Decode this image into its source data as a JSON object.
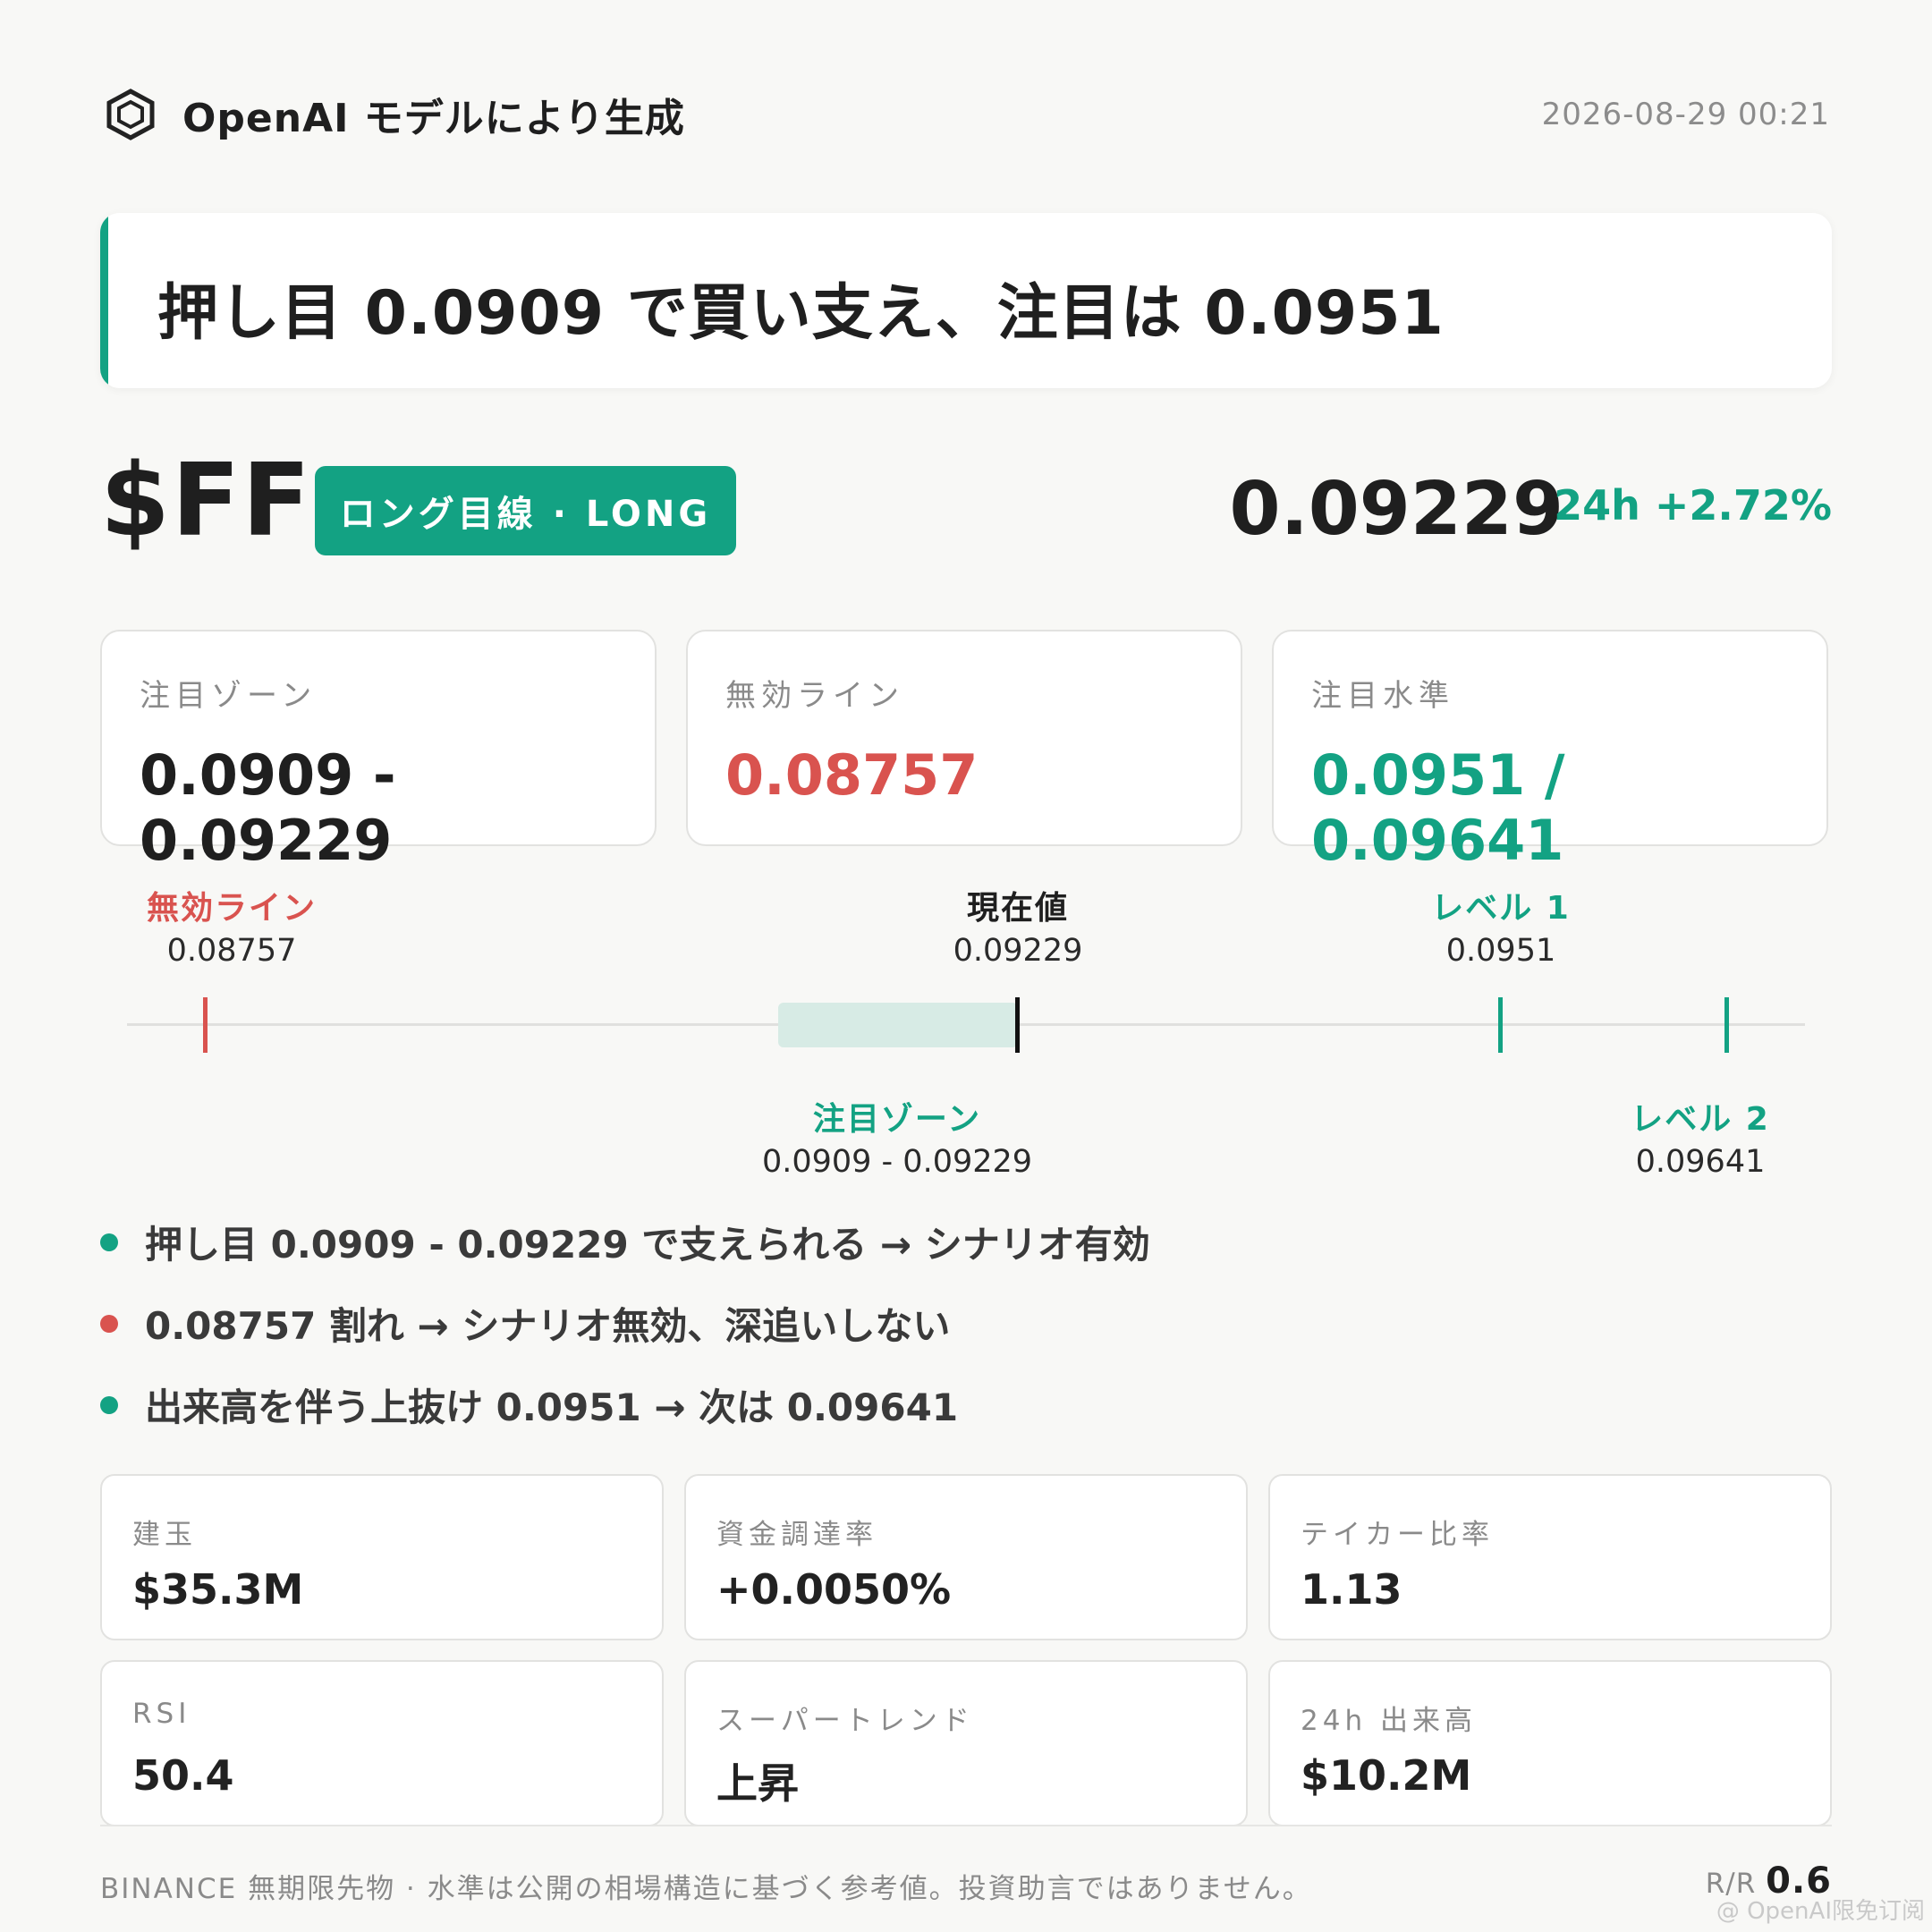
{
  "header": {
    "title": "OpenAI モデルにより生成",
    "timestamp": "2026-08-29 00:21"
  },
  "headline": "押し目 0.0909 で買い支え、注目は 0.0951",
  "ticker": {
    "symbol": "$FF",
    "badge": "ロング目線 · LONG",
    "price": "0.09229",
    "change": "24h +2.72%"
  },
  "levels": [
    {
      "label": "注目ゾーン",
      "value": "0.0909 - 0.09229",
      "color": "#1f1f1f"
    },
    {
      "label": "無効ライン",
      "value": "0.08757",
      "color": "#d9534f"
    },
    {
      "label": "注目水準",
      "value": "0.0951 / 0.09641",
      "color": "#13a283"
    }
  ],
  "track": {
    "invalid": {
      "label": "無効ライン",
      "value": "0.08757"
    },
    "current": {
      "label": "現在値",
      "value": "0.09229"
    },
    "level1": {
      "label": "レベル 1",
      "value": "0.0951"
    },
    "zone": {
      "label": "注目ゾーン",
      "value": "0.0909 - 0.09229"
    },
    "level2": {
      "label": "レベル 2",
      "value": "0.09641"
    }
  },
  "bullets": [
    {
      "text": "押し目 0.0909 - 0.09229 で支えられる → シナリオ有効",
      "color": "#13a283"
    },
    {
      "text": "0.08757 割れ → シナリオ無効、深追いしない",
      "color": "#d9534f"
    },
    {
      "text": "出来高を伴う上抜け 0.0951 → 次は 0.09641",
      "color": "#13a283"
    }
  ],
  "metrics": [
    {
      "label": "建玉",
      "value": "$35.3M"
    },
    {
      "label": "資金調達率",
      "value": "+0.0050%"
    },
    {
      "label": "テイカー比率",
      "value": "1.13"
    },
    {
      "label": "RSI",
      "value": "50.4"
    },
    {
      "label": "スーパートレンド",
      "value": "上昇"
    },
    {
      "label": "24h 出来高",
      "value": "$10.2M"
    }
  ],
  "footer": {
    "note": "BINANCE 無期限先物 · 水準は公開の相場構造に基づく参考値。投資助言ではありません。",
    "rr_label": "R/R",
    "rr_value": "0.6"
  },
  "watermark": "@ OpenAI限免订阅",
  "colors": {
    "accent": "#13a283",
    "danger": "#d9534f"
  }
}
